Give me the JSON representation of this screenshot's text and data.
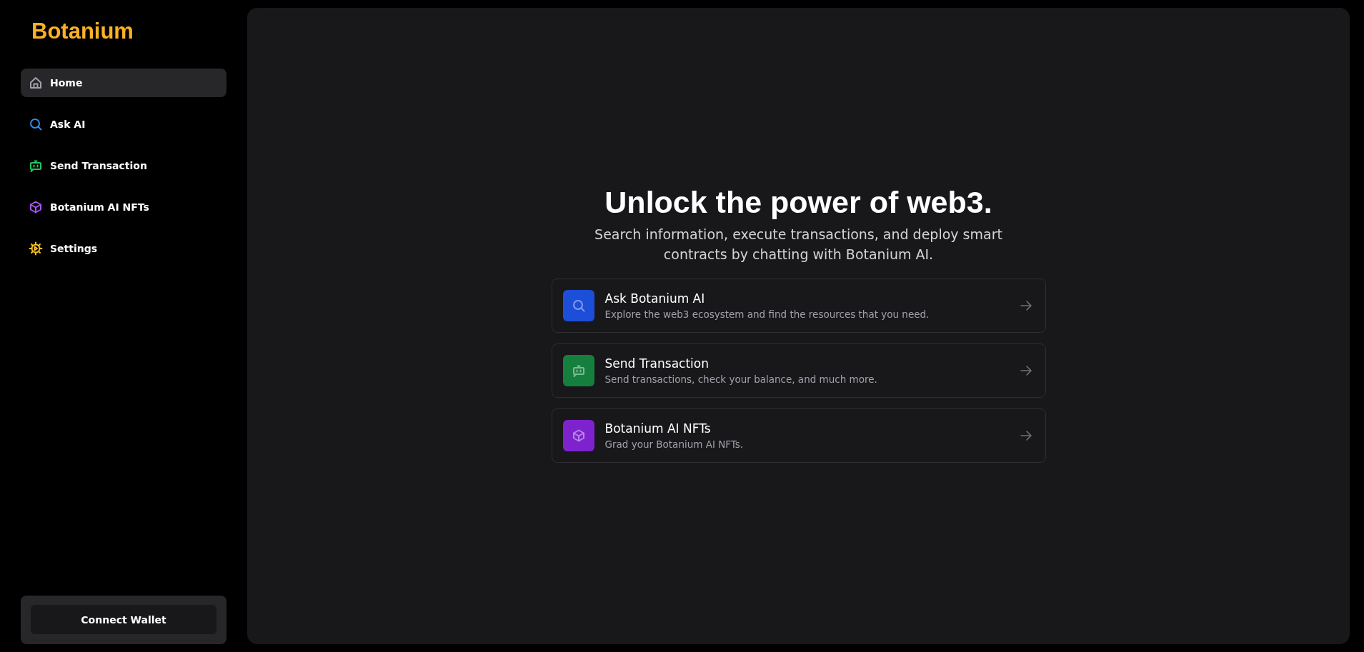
{
  "sidebar": {
    "logo": "Botanium",
    "items": [
      {
        "label": "Home",
        "kind": "home",
        "color": "#a1a1aa",
        "selected": true
      },
      {
        "label": "Ask AI",
        "kind": "search",
        "color": "#2f8fe8",
        "selected": false
      },
      {
        "label": "Send Transaction",
        "kind": "bot",
        "color": "#22c55e",
        "selected": false
      },
      {
        "label": "Botanium AI NFTs",
        "kind": "cube",
        "color": "#a855f7",
        "selected": false
      },
      {
        "label": "Settings",
        "kind": "gear",
        "color": "#fbbf24",
        "selected": false
      }
    ],
    "connect_button": "Connect Wallet"
  },
  "main": {
    "title": "Unlock the power of web3.",
    "subtitle": "Search information, execute transactions, and deploy smart contracts by chatting with Botanium AI.",
    "cards": [
      {
        "title": "Ask Botanium AI",
        "description": "Explore the web3 ecosystem and find the resources that you need.",
        "kind": "search",
        "color": "#1d4ed8"
      },
      {
        "title": "Send Transaction",
        "description": "Send transactions, check your balance, and much more.",
        "kind": "bot",
        "color": "#15803d"
      },
      {
        "title": "Botanium AI NFTs",
        "description": "Grad your Botanium AI NFTs.",
        "kind": "cube",
        "color": "#7e22ce"
      }
    ]
  }
}
